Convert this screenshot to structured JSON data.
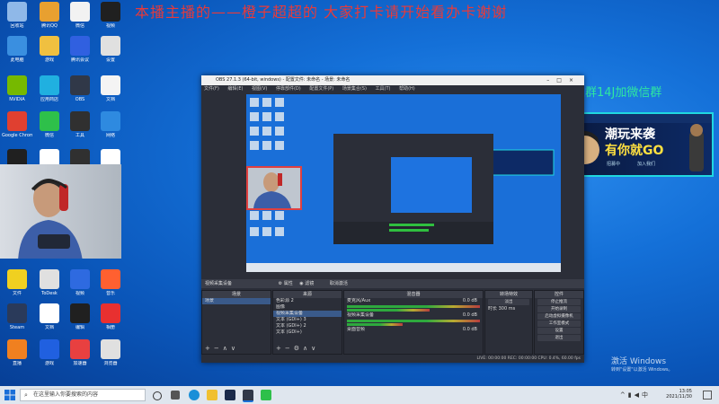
{
  "overlay": {
    "banner": "本播主播的——橙子超超的    大家打卡请开始看办卡谢谢",
    "group_text": "粉丝群14J加微信群",
    "promo": {
      "line1": "潮玩来袭",
      "line2": "有你就GO",
      "small1": "招募中",
      "small2": "加入我们"
    }
  },
  "desktop_icons": [
    {
      "label": "回收站",
      "color": "#8fb8e8"
    },
    {
      "label": "腾讯QQ",
      "color": "#e8a030"
    },
    {
      "label": "微信",
      "color": "#f2f2f2"
    },
    {
      "label": "视频",
      "color": "#202020"
    },
    {
      "label": "此电脑",
      "color": "#3a8fe0"
    },
    {
      "label": "游戏",
      "color": "#f0c040"
    },
    {
      "label": "腾讯会议",
      "color": "#3060e0"
    },
    {
      "label": "设置",
      "color": "#e0e0e0"
    },
    {
      "label": "NVIDIA",
      "color": "#76b900"
    },
    {
      "label": "应用商店",
      "color": "#20b0e0"
    },
    {
      "label": "OBS",
      "color": "#303848"
    },
    {
      "label": "文档",
      "color": "#f4f4f4"
    },
    {
      "label": "Google Chrome",
      "color": "#e04030"
    },
    {
      "label": "微信",
      "color": "#2ec04a"
    },
    {
      "label": "工具",
      "color": "#303030"
    },
    {
      "label": "网络",
      "color": "#2e8ae0"
    },
    {
      "label": "G HUB",
      "color": "#202020"
    },
    {
      "label": "通知",
      "color": "#ffffff"
    },
    {
      "label": "酷狗",
      "color": "#303030"
    },
    {
      "label": "Steam",
      "color": "#ffffff"
    },
    {
      "label": "文件",
      "color": "#f0d020"
    },
    {
      "label": "ToDesk",
      "color": "#e0e0e0"
    },
    {
      "label": "视频",
      "color": "#2e6ae0"
    },
    {
      "label": "音乐",
      "color": "#ff6030"
    },
    {
      "label": "Steam",
      "color": "#2a3a5a"
    },
    {
      "label": "文档",
      "color": "#ffffff"
    },
    {
      "label": "编辑",
      "color": "#202020"
    },
    {
      "label": "相册",
      "color": "#e83030"
    },
    {
      "label": "直播",
      "color": "#f08020"
    },
    {
      "label": "游戏",
      "color": "#2060e0"
    },
    {
      "label": "加速器",
      "color": "#e84040"
    },
    {
      "label": "浏览器",
      "color": "#e0e0e0"
    }
  ],
  "obs": {
    "title": "OBS 27.1.3 (64-bit, windows) - 配置文件: 未命名 - 场景: 未命名",
    "menus": [
      "文件(F)",
      "编辑(E)",
      "视图(V)",
      "停靠部件(D)",
      "配置文件(P)",
      "场景集合(S)",
      "工具(T)",
      "帮助(H)"
    ],
    "source_bar": "视频采集设备",
    "source_props": "属性",
    "source_filters": "滤镜",
    "source_deactivate": "取消激活",
    "docks": {
      "scenes": {
        "title": "场景",
        "items": [
          "场景"
        ]
      },
      "sources": {
        "title": "来源",
        "items": [
          "色彩源 2",
          "图像",
          "视频采集设备",
          "文本 (GDI+) 3",
          "文本 (GDI+) 2",
          "文本 (GDI+)"
        ]
      },
      "mixer": {
        "title": "混音器",
        "channels": [
          {
            "name": "麦克风/Aux",
            "db": "0.0 dB"
          },
          {
            "name": "视频采集设备",
            "db": "0.0 dB"
          },
          {
            "name": "桌面音频",
            "db": "0.0 dB"
          }
        ]
      },
      "transitions": {
        "title": "转场特效",
        "type": "淡出",
        "duration_label": "时长",
        "duration": "300 ms"
      },
      "controls": {
        "title": "控件",
        "buttons": [
          "停止推流",
          "开始录制",
          "启动虚拟摄像机",
          "工作室模式",
          "设置",
          "退出"
        ]
      }
    },
    "status": "LIVE: 00:00:00   REC: 00:00:00   CPU: 0.4%, 60.00 fps"
  },
  "activate": {
    "line1": "激活 Windows",
    "line2": "转到\"设置\"以激活 Windows。"
  },
  "taskbar": {
    "search_placeholder": "在这里输入你要搜索的内容",
    "time": "13:05",
    "date": "2021/11/30",
    "ime": "中"
  }
}
